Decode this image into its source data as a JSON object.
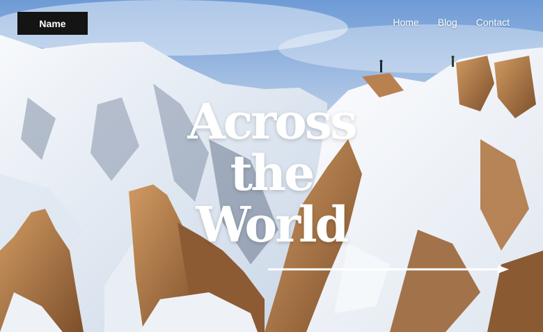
{
  "brand": {
    "name": "Name"
  },
  "nav": {
    "items": [
      {
        "label": "Home"
      },
      {
        "label": "Blog"
      },
      {
        "label": "Contact"
      }
    ]
  },
  "hero": {
    "title_lines": [
      "Across",
      "the",
      "World"
    ],
    "arrow_icon": "arrow-right-icon"
  },
  "colors": {
    "sky": "#a9c3e6",
    "snow": "#f3f6fa",
    "rock": "#b77a45",
    "text": "#ffffff",
    "logo_bg": "#141414"
  }
}
